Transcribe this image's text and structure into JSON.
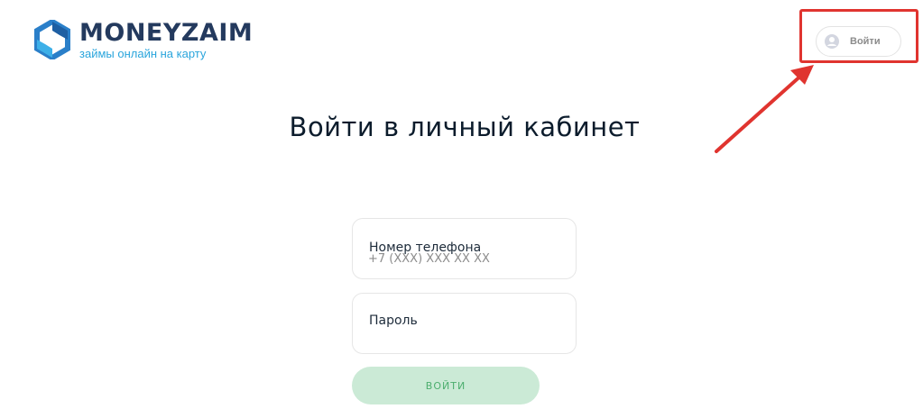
{
  "brand": {
    "name": "MONEYZAIM",
    "tagline": "займы онлайн на карту",
    "colors": {
      "primary": "#243a5e",
      "accent": "#2aa5dc"
    }
  },
  "header": {
    "login_button": {
      "icon": "user-icon",
      "label": "Войти"
    },
    "highlight_color": "#e0342f"
  },
  "main": {
    "title": "Войти в личный кабинет",
    "form": {
      "phone": {
        "label": "Номер телефона",
        "placeholder": "+7 (XXX) XXX XX XX",
        "value": ""
      },
      "password": {
        "label": "Пароль",
        "value": ""
      },
      "submit_label": "ВОЙТИ",
      "submit_color": "#cbead6"
    }
  },
  "annotation": {
    "arrow_color": "#e0342f"
  }
}
